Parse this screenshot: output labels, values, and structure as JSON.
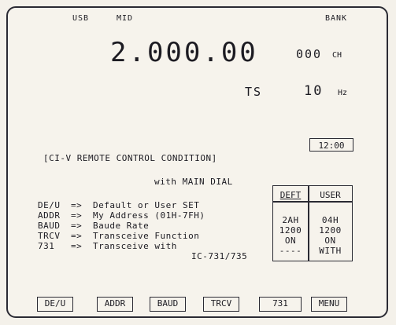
{
  "status": {
    "mode": "USB",
    "agc": "MID",
    "bank": "BANK"
  },
  "frequency": {
    "value": "2.000.00",
    "channel_digits": "000",
    "channel_suffix": "CH"
  },
  "tuning_step": {
    "label": "TS",
    "value": "10",
    "unit": "Hz"
  },
  "clock": "12:00",
  "title": "[CI-V REMOTE CONTROL CONDITION]",
  "subtitle": "with MAIN DIAL",
  "menu_items": [
    {
      "key": "DE/U",
      "arrow": "=>",
      "desc": "Default or User SET"
    },
    {
      "key": "ADDR",
      "arrow": "=>",
      "desc": "My Address (01H-7FH)"
    },
    {
      "key": "BAUD",
      "arrow": "=>",
      "desc": "Baude Rate"
    },
    {
      "key": "TRCV",
      "arrow": "=>",
      "desc": "Transceive Function"
    },
    {
      "key": "731",
      "arrow": "=>",
      "desc": "Transceive with"
    }
  ],
  "extra_line": "IC-731/735",
  "settings_table": {
    "headers": [
      "DEFT",
      "USER"
    ],
    "rows": [
      [
        "2AH",
        "04H"
      ],
      [
        "1200",
        "1200"
      ],
      [
        "ON",
        "ON"
      ],
      [
        "----",
        "WITH"
      ]
    ]
  },
  "softkeys": [
    "DE/U",
    "ADDR",
    "BAUD",
    "TRCV",
    "731",
    "MENU"
  ]
}
